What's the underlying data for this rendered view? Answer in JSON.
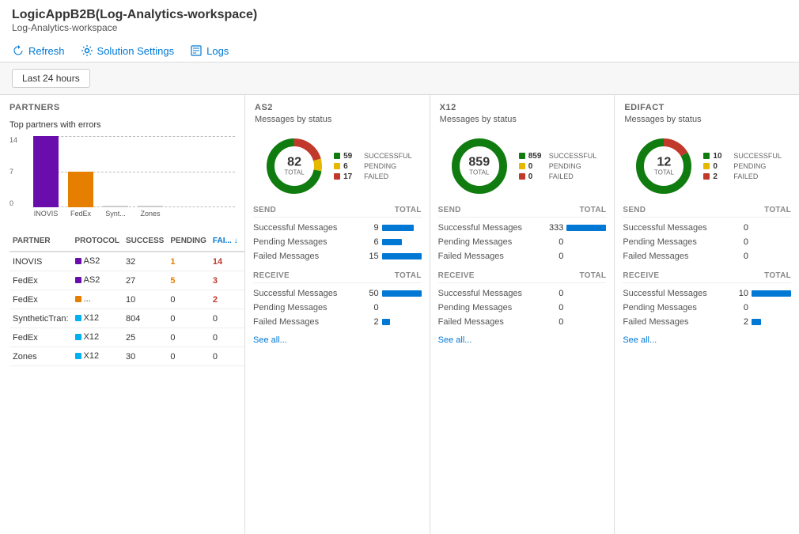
{
  "header": {
    "title": "LogicAppB2B(Log-Analytics-workspace)",
    "subtitle": "Log-Analytics-workspace",
    "toolbar": {
      "refresh": "Refresh",
      "solution_settings": "Solution Settings",
      "logs": "Logs"
    }
  },
  "time_filter": {
    "label": "Last 24 hours"
  },
  "partners": {
    "section_title": "PARTNERS",
    "chart_label": "Top partners with errors",
    "y_labels": [
      "14",
      "7",
      "0"
    ],
    "bars": [
      {
        "name": "INOVIS",
        "value": 14,
        "color": "#6a0dad",
        "height": 90
      },
      {
        "name": "FedEx",
        "value": 7,
        "color": "#e67e00",
        "height": 45
      },
      {
        "name": "Synt...",
        "value": 0,
        "color": "#999",
        "height": 0
      },
      {
        "name": "Zones",
        "value": 0,
        "color": "#999",
        "height": 0
      }
    ],
    "table": {
      "columns": [
        "PARTNER",
        "PROTOCOL",
        "SUCCESS",
        "PENDING",
        "FAI..."
      ],
      "rows": [
        {
          "partner": "INOVIS",
          "protocol": "AS2",
          "proto_color": "#6a0dad",
          "success": "32",
          "pending": "1",
          "pending_color": "orange",
          "failed": "14",
          "failed_color": "red"
        },
        {
          "partner": "FedEx",
          "protocol": "AS2",
          "proto_color": "#6a0dad",
          "success": "27",
          "pending": "5",
          "pending_color": "orange",
          "failed": "3",
          "failed_color": "red"
        },
        {
          "partner": "FedEx",
          "protocol": "...",
          "proto_color": "#e67e00",
          "success": "10",
          "pending": "0",
          "pending_color": "",
          "failed": "2",
          "failed_color": "red"
        },
        {
          "partner": "SyntheticTran:",
          "protocol": "X12",
          "proto_color": "#00b0f0",
          "success": "804",
          "pending": "0",
          "pending_color": "",
          "failed": "0",
          "failed_color": ""
        },
        {
          "partner": "FedEx",
          "protocol": "X12",
          "proto_color": "#00b0f0",
          "success": "25",
          "pending": "0",
          "pending_color": "",
          "failed": "0",
          "failed_color": ""
        },
        {
          "partner": "Zones",
          "protocol": "X12",
          "proto_color": "#00b0f0",
          "success": "30",
          "pending": "0",
          "pending_color": "",
          "failed": "0",
          "failed_color": ""
        }
      ]
    }
  },
  "as2": {
    "title": "AS2",
    "subtitle": "Messages by status",
    "donut": {
      "total": 82,
      "total_label": "TOTAL",
      "successful": 59,
      "pending": 6,
      "failed": 17
    },
    "legend": {
      "successful_label": "SUCCESSFUL",
      "pending_label": "PENDING",
      "failed_label": "FAILED",
      "successful_color": "#107c10",
      "pending_color": "#e6b800",
      "failed_color": "#c0392b"
    },
    "send": {
      "label": "SEND",
      "total_label": "TOTAL",
      "successful": 9,
      "pending": 6,
      "failed": 15,
      "successful_bar": 40,
      "pending_bar": 25,
      "failed_bar": 60
    },
    "receive": {
      "label": "RECEIVE",
      "total_label": "TOTAL",
      "successful": 50,
      "pending": 0,
      "failed": 2,
      "successful_bar": 80,
      "pending_bar": 0,
      "failed_bar": 10
    },
    "see_all": "See all..."
  },
  "x12": {
    "title": "X12",
    "subtitle": "Messages by status",
    "donut": {
      "total": 859,
      "total_label": "TOTAL",
      "successful": 859,
      "pending": 0,
      "failed": 0
    },
    "send": {
      "label": "SEND",
      "total_label": "TOTAL",
      "successful": 333,
      "pending": 0,
      "failed": 0,
      "successful_bar": 80,
      "pending_bar": 0,
      "failed_bar": 0
    },
    "receive": {
      "label": "RECEIVE",
      "total_label": "TOTAL",
      "successful": 0,
      "pending": 0,
      "failed": 0,
      "successful_bar": 0,
      "pending_bar": 0,
      "failed_bar": 0
    },
    "see_all": "See all..."
  },
  "edifact": {
    "title": "EDIFACT",
    "subtitle": "Messages by status",
    "donut": {
      "total": 12,
      "total_label": "TOTAL",
      "successful": 10,
      "pending": 0,
      "failed": 2
    },
    "send": {
      "label": "SEND",
      "total_label": "TOTAL",
      "successful": 0,
      "pending": 0,
      "failed": 0,
      "successful_bar": 0,
      "pending_bar": 0,
      "failed_bar": 0
    },
    "receive": {
      "label": "RECEIVE",
      "total_label": "TOTAL",
      "successful": 10,
      "pending": 0,
      "failed": 2,
      "successful_bar": 80,
      "pending_bar": 0,
      "failed_bar": 15
    },
    "see_all": "See all..."
  },
  "colors": {
    "successful": "#107c10",
    "pending": "#e6b800",
    "failed": "#c0392b",
    "bar_blue": "#0078d4",
    "bar_small": "#00b0f0"
  }
}
